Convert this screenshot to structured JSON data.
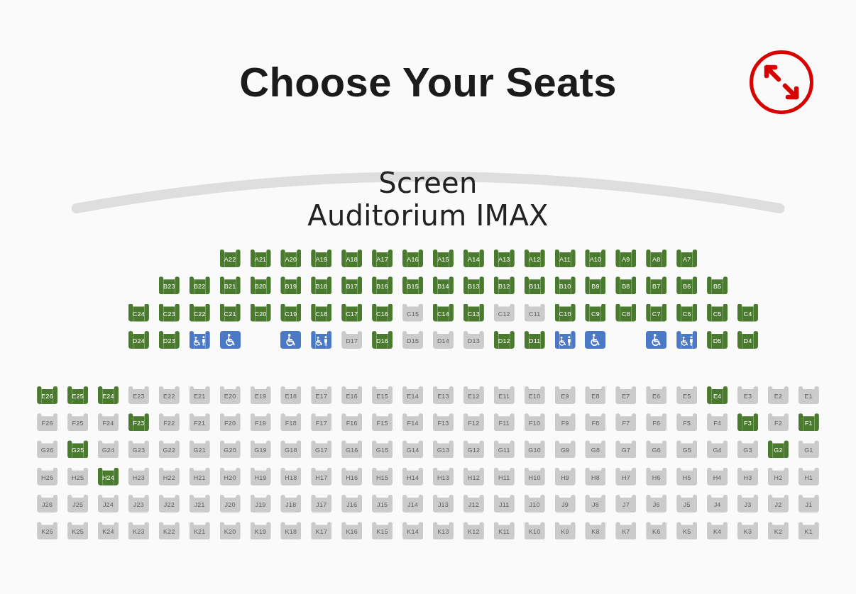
{
  "header": {
    "title": "Choose Your Seats"
  },
  "screen": {
    "label": "Screen",
    "auditorium": "Auditorium IMAX"
  },
  "sections": [
    {
      "rows": [
        {
          "seats": [
            {
              "kind": "gap"
            },
            {
              "kind": "gap"
            },
            {
              "kind": "gap"
            },
            {
              "kind": "gap"
            },
            {
              "kind": "gap"
            },
            {
              "kind": "gap"
            },
            {
              "kind": "standard",
              "label": "A22",
              "available": true
            },
            {
              "kind": "standard",
              "label": "A21",
              "available": true
            },
            {
              "kind": "standard",
              "label": "A20",
              "available": true
            },
            {
              "kind": "standard",
              "label": "A19",
              "available": true
            },
            {
              "kind": "standard",
              "label": "A18",
              "available": true
            },
            {
              "kind": "standard",
              "label": "A17",
              "available": true
            },
            {
              "kind": "standard",
              "label": "A16",
              "available": true
            },
            {
              "kind": "standard",
              "label": "A15",
              "available": true
            },
            {
              "kind": "standard",
              "label": "A14",
              "available": true
            },
            {
              "kind": "standard",
              "label": "A13",
              "available": true
            },
            {
              "kind": "standard",
              "label": "A12",
              "available": true
            },
            {
              "kind": "standard",
              "label": "A11",
              "available": true
            },
            {
              "kind": "standard",
              "label": "A10",
              "available": true
            },
            {
              "kind": "standard",
              "label": "A9",
              "available": true
            },
            {
              "kind": "standard",
              "label": "A8",
              "available": true
            },
            {
              "kind": "standard",
              "label": "A7",
              "available": true
            }
          ]
        },
        {
          "seats": [
            {
              "kind": "gap"
            },
            {
              "kind": "gap"
            },
            {
              "kind": "gap"
            },
            {
              "kind": "gap"
            },
            {
              "kind": "standard",
              "label": "B23",
              "available": true
            },
            {
              "kind": "standard",
              "label": "B22",
              "available": true
            },
            {
              "kind": "standard",
              "label": "B21",
              "available": true
            },
            {
              "kind": "standard",
              "label": "B20",
              "available": true
            },
            {
              "kind": "standard",
              "label": "B19",
              "available": true
            },
            {
              "kind": "standard",
              "label": "B18",
              "available": true
            },
            {
              "kind": "standard",
              "label": "B17",
              "available": true
            },
            {
              "kind": "standard",
              "label": "B16",
              "available": true
            },
            {
              "kind": "standard",
              "label": "B15",
              "available": true
            },
            {
              "kind": "standard",
              "label": "B14",
              "available": true
            },
            {
              "kind": "standard",
              "label": "B13",
              "available": true
            },
            {
              "kind": "standard",
              "label": "B12",
              "available": true
            },
            {
              "kind": "standard",
              "label": "B11",
              "available": true
            },
            {
              "kind": "standard",
              "label": "B10",
              "available": true
            },
            {
              "kind": "standard",
              "label": "B9",
              "available": true
            },
            {
              "kind": "standard",
              "label": "B8",
              "available": true
            },
            {
              "kind": "standard",
              "label": "B7",
              "available": true
            },
            {
              "kind": "standard",
              "label": "B6",
              "available": true
            },
            {
              "kind": "standard",
              "label": "B5",
              "available": true
            }
          ]
        },
        {
          "seats": [
            {
              "kind": "gap"
            },
            {
              "kind": "gap"
            },
            {
              "kind": "gap"
            },
            {
              "kind": "standard",
              "label": "C24",
              "available": true
            },
            {
              "kind": "standard",
              "label": "C23",
              "available": true
            },
            {
              "kind": "standard",
              "label": "C22",
              "available": true
            },
            {
              "kind": "standard",
              "label": "C21",
              "available": true
            },
            {
              "kind": "standard",
              "label": "C20",
              "available": true
            },
            {
              "kind": "standard",
              "label": "C19",
              "available": true
            },
            {
              "kind": "standard",
              "label": "C18",
              "available": true
            },
            {
              "kind": "standard",
              "label": "C17",
              "available": true
            },
            {
              "kind": "standard",
              "label": "C16",
              "available": true
            },
            {
              "kind": "standard",
              "label": "C15",
              "available": false
            },
            {
              "kind": "standard",
              "label": "C14",
              "available": true
            },
            {
              "kind": "standard",
              "label": "C13",
              "available": true
            },
            {
              "kind": "standard",
              "label": "C12",
              "available": false
            },
            {
              "kind": "standard",
              "label": "C11",
              "available": false
            },
            {
              "kind": "standard",
              "label": "C10",
              "available": true
            },
            {
              "kind": "standard",
              "label": "C9",
              "available": true
            },
            {
              "kind": "standard",
              "label": "C8",
              "available": true
            },
            {
              "kind": "standard",
              "label": "C7",
              "available": true
            },
            {
              "kind": "standard",
              "label": "C6",
              "available": true
            },
            {
              "kind": "standard",
              "label": "C5",
              "available": true
            },
            {
              "kind": "standard",
              "label": "C4",
              "available": true
            }
          ]
        },
        {
          "seats": [
            {
              "kind": "gap"
            },
            {
              "kind": "gap"
            },
            {
              "kind": "gap"
            },
            {
              "kind": "standard",
              "label": "D24",
              "available": true
            },
            {
              "kind": "standard",
              "label": "D23",
              "available": true
            },
            {
              "kind": "companion",
              "available": true
            },
            {
              "kind": "wheelchair",
              "available": true
            },
            {
              "kind": "gap"
            },
            {
              "kind": "wheelchair",
              "available": true
            },
            {
              "kind": "companion",
              "available": true
            },
            {
              "kind": "standard",
              "label": "D17",
              "available": false
            },
            {
              "kind": "standard",
              "label": "D16",
              "available": true
            },
            {
              "kind": "standard",
              "label": "D15",
              "available": false
            },
            {
              "kind": "standard",
              "label": "D14",
              "available": false
            },
            {
              "kind": "standard",
              "label": "D13",
              "available": false
            },
            {
              "kind": "standard",
              "label": "D12",
              "available": true
            },
            {
              "kind": "standard",
              "label": "D11",
              "available": true
            },
            {
              "kind": "companion",
              "available": true
            },
            {
              "kind": "wheelchair",
              "available": true
            },
            {
              "kind": "gap"
            },
            {
              "kind": "wheelchair",
              "available": true
            },
            {
              "kind": "companion",
              "available": true
            },
            {
              "kind": "standard",
              "label": "D5",
              "available": true
            },
            {
              "kind": "standard",
              "label": "D4",
              "available": true
            }
          ]
        }
      ]
    },
    {
      "rows": [
        {
          "seats": [
            {
              "kind": "standard",
              "label": "E26",
              "available": true
            },
            {
              "kind": "standard",
              "label": "E25",
              "available": true
            },
            {
              "kind": "standard",
              "label": "E24",
              "available": true
            },
            {
              "kind": "standard",
              "label": "E23",
              "available": false
            },
            {
              "kind": "standard",
              "label": "E22",
              "available": false
            },
            {
              "kind": "standard",
              "label": "E21",
              "available": false
            },
            {
              "kind": "standard",
              "label": "E20",
              "available": false
            },
            {
              "kind": "standard",
              "label": "E19",
              "available": false
            },
            {
              "kind": "standard",
              "label": "E18",
              "available": false
            },
            {
              "kind": "standard",
              "label": "E17",
              "available": false
            },
            {
              "kind": "standard",
              "label": "E16",
              "available": false
            },
            {
              "kind": "standard",
              "label": "E15",
              "available": false
            },
            {
              "kind": "standard",
              "label": "E14",
              "available": false
            },
            {
              "kind": "standard",
              "label": "E13",
              "available": false
            },
            {
              "kind": "standard",
              "label": "E12",
              "available": false
            },
            {
              "kind": "standard",
              "label": "E11",
              "available": false
            },
            {
              "kind": "standard",
              "label": "E10",
              "available": false
            },
            {
              "kind": "standard",
              "label": "E9",
              "available": false
            },
            {
              "kind": "standard",
              "label": "E8",
              "available": false
            },
            {
              "kind": "standard",
              "label": "E7",
              "available": false
            },
            {
              "kind": "standard",
              "label": "E6",
              "available": false
            },
            {
              "kind": "standard",
              "label": "E5",
              "available": false
            },
            {
              "kind": "standard",
              "label": "E4",
              "available": true
            },
            {
              "kind": "standard",
              "label": "E3",
              "available": false
            },
            {
              "kind": "standard",
              "label": "E2",
              "available": false
            },
            {
              "kind": "standard",
              "label": "E1",
              "available": false
            }
          ]
        },
        {
          "seats": [
            {
              "kind": "standard",
              "label": "F26",
              "available": false
            },
            {
              "kind": "standard",
              "label": "F25",
              "available": false
            },
            {
              "kind": "standard",
              "label": "F24",
              "available": false
            },
            {
              "kind": "standard",
              "label": "F23",
              "available": true
            },
            {
              "kind": "standard",
              "label": "F22",
              "available": false
            },
            {
              "kind": "standard",
              "label": "F21",
              "available": false
            },
            {
              "kind": "standard",
              "label": "F20",
              "available": false
            },
            {
              "kind": "standard",
              "label": "F19",
              "available": false
            },
            {
              "kind": "standard",
              "label": "F18",
              "available": false
            },
            {
              "kind": "standard",
              "label": "F17",
              "available": false
            },
            {
              "kind": "standard",
              "label": "F16",
              "available": false
            },
            {
              "kind": "standard",
              "label": "F15",
              "available": false
            },
            {
              "kind": "standard",
              "label": "F14",
              "available": false
            },
            {
              "kind": "standard",
              "label": "F13",
              "available": false
            },
            {
              "kind": "standard",
              "label": "F12",
              "available": false
            },
            {
              "kind": "standard",
              "label": "F11",
              "available": false
            },
            {
              "kind": "standard",
              "label": "F10",
              "available": false
            },
            {
              "kind": "standard",
              "label": "F9",
              "available": false
            },
            {
              "kind": "standard",
              "label": "F8",
              "available": false
            },
            {
              "kind": "standard",
              "label": "F7",
              "available": false
            },
            {
              "kind": "standard",
              "label": "F6",
              "available": false
            },
            {
              "kind": "standard",
              "label": "F5",
              "available": false
            },
            {
              "kind": "standard",
              "label": "F4",
              "available": false
            },
            {
              "kind": "standard",
              "label": "F3",
              "available": true
            },
            {
              "kind": "standard",
              "label": "F2",
              "available": false
            },
            {
              "kind": "standard",
              "label": "F1",
              "available": true
            }
          ]
        },
        {
          "seats": [
            {
              "kind": "standard",
              "label": "G26",
              "available": false
            },
            {
              "kind": "standard",
              "label": "G25",
              "available": true
            },
            {
              "kind": "standard",
              "label": "G24",
              "available": false
            },
            {
              "kind": "standard",
              "label": "G23",
              "available": false
            },
            {
              "kind": "standard",
              "label": "G22",
              "available": false
            },
            {
              "kind": "standard",
              "label": "G21",
              "available": false
            },
            {
              "kind": "standard",
              "label": "G20",
              "available": false
            },
            {
              "kind": "standard",
              "label": "G19",
              "available": false
            },
            {
              "kind": "standard",
              "label": "G18",
              "available": false
            },
            {
              "kind": "standard",
              "label": "G17",
              "available": false
            },
            {
              "kind": "standard",
              "label": "G16",
              "available": false
            },
            {
              "kind": "standard",
              "label": "G15",
              "available": false
            },
            {
              "kind": "standard",
              "label": "G14",
              "available": false
            },
            {
              "kind": "standard",
              "label": "G13",
              "available": false
            },
            {
              "kind": "standard",
              "label": "G12",
              "available": false
            },
            {
              "kind": "standard",
              "label": "G11",
              "available": false
            },
            {
              "kind": "standard",
              "label": "G10",
              "available": false
            },
            {
              "kind": "standard",
              "label": "G9",
              "available": false
            },
            {
              "kind": "standard",
              "label": "G8",
              "available": false
            },
            {
              "kind": "standard",
              "label": "G7",
              "available": false
            },
            {
              "kind": "standard",
              "label": "G6",
              "available": false
            },
            {
              "kind": "standard",
              "label": "G5",
              "available": false
            },
            {
              "kind": "standard",
              "label": "G4",
              "available": false
            },
            {
              "kind": "standard",
              "label": "G3",
              "available": false
            },
            {
              "kind": "standard",
              "label": "G2",
              "available": true
            },
            {
              "kind": "standard",
              "label": "G1",
              "available": false
            }
          ]
        },
        {
          "seats": [
            {
              "kind": "standard",
              "label": "H26",
              "available": false
            },
            {
              "kind": "standard",
              "label": "H25",
              "available": false
            },
            {
              "kind": "standard",
              "label": "H24",
              "available": true
            },
            {
              "kind": "standard",
              "label": "H23",
              "available": false
            },
            {
              "kind": "standard",
              "label": "H22",
              "available": false
            },
            {
              "kind": "standard",
              "label": "H21",
              "available": false
            },
            {
              "kind": "standard",
              "label": "H20",
              "available": false
            },
            {
              "kind": "standard",
              "label": "H19",
              "available": false
            },
            {
              "kind": "standard",
              "label": "H18",
              "available": false
            },
            {
              "kind": "standard",
              "label": "H17",
              "available": false
            },
            {
              "kind": "standard",
              "label": "H16",
              "available": false
            },
            {
              "kind": "standard",
              "label": "H15",
              "available": false
            },
            {
              "kind": "standard",
              "label": "H14",
              "available": false
            },
            {
              "kind": "standard",
              "label": "H13",
              "available": false
            },
            {
              "kind": "standard",
              "label": "H12",
              "available": false
            },
            {
              "kind": "standard",
              "label": "H11",
              "available": false
            },
            {
              "kind": "standard",
              "label": "H10",
              "available": false
            },
            {
              "kind": "standard",
              "label": "H9",
              "available": false
            },
            {
              "kind": "standard",
              "label": "H8",
              "available": false
            },
            {
              "kind": "standard",
              "label": "H7",
              "available": false
            },
            {
              "kind": "standard",
              "label": "H6",
              "available": false
            },
            {
              "kind": "standard",
              "label": "H5",
              "available": false
            },
            {
              "kind": "standard",
              "label": "H4",
              "available": false
            },
            {
              "kind": "standard",
              "label": "H3",
              "available": false
            },
            {
              "kind": "standard",
              "label": "H2",
              "available": false
            },
            {
              "kind": "standard",
              "label": "H1",
              "available": false
            }
          ]
        },
        {
          "seats": [
            {
              "kind": "standard",
              "label": "J26",
              "available": false
            },
            {
              "kind": "standard",
              "label": "J25",
              "available": false
            },
            {
              "kind": "standard",
              "label": "J24",
              "available": false
            },
            {
              "kind": "standard",
              "label": "J23",
              "available": false
            },
            {
              "kind": "standard",
              "label": "J22",
              "available": false
            },
            {
              "kind": "standard",
              "label": "J21",
              "available": false
            },
            {
              "kind": "standard",
              "label": "J20",
              "available": false
            },
            {
              "kind": "standard",
              "label": "J19",
              "available": false
            },
            {
              "kind": "standard",
              "label": "J18",
              "available": false
            },
            {
              "kind": "standard",
              "label": "J17",
              "available": false
            },
            {
              "kind": "standard",
              "label": "J16",
              "available": false
            },
            {
              "kind": "standard",
              "label": "J15",
              "available": false
            },
            {
              "kind": "standard",
              "label": "J14",
              "available": false
            },
            {
              "kind": "standard",
              "label": "J13",
              "available": false
            },
            {
              "kind": "standard",
              "label": "J12",
              "available": false
            },
            {
              "kind": "standard",
              "label": "J11",
              "available": false
            },
            {
              "kind": "standard",
              "label": "J10",
              "available": false
            },
            {
              "kind": "standard",
              "label": "J9",
              "available": false
            },
            {
              "kind": "standard",
              "label": "J8",
              "available": false
            },
            {
              "kind": "standard",
              "label": "J7",
              "available": false
            },
            {
              "kind": "standard",
              "label": "J6",
              "available": false
            },
            {
              "kind": "standard",
              "label": "J5",
              "available": false
            },
            {
              "kind": "standard",
              "label": "J4",
              "available": false
            },
            {
              "kind": "standard",
              "label": "J3",
              "available": false
            },
            {
              "kind": "standard",
              "label": "J2",
              "available": false
            },
            {
              "kind": "standard",
              "label": "J1",
              "available": false
            }
          ]
        },
        {
          "seats": [
            {
              "kind": "standard",
              "label": "K26",
              "available": false
            },
            {
              "kind": "standard",
              "label": "K25",
              "available": false
            },
            {
              "kind": "standard",
              "label": "K24",
              "available": false
            },
            {
              "kind": "standard",
              "label": "K23",
              "available": false
            },
            {
              "kind": "standard",
              "label": "K22",
              "available": false
            },
            {
              "kind": "standard",
              "label": "K21",
              "available": false
            },
            {
              "kind": "standard",
              "label": "K20",
              "available": false
            },
            {
              "kind": "standard",
              "label": "K19",
              "available": false
            },
            {
              "kind": "standard",
              "label": "K18",
              "available": false
            },
            {
              "kind": "standard",
              "label": "K17",
              "available": false
            },
            {
              "kind": "standard",
              "label": "K16",
              "available": false
            },
            {
              "kind": "standard",
              "label": "K15",
              "available": false
            },
            {
              "kind": "standard",
              "label": "K14",
              "available": false
            },
            {
              "kind": "standard",
              "label": "K13",
              "available": false
            },
            {
              "kind": "standard",
              "label": "K12",
              "available": false
            },
            {
              "kind": "standard",
              "label": "K11",
              "available": false
            },
            {
              "kind": "standard",
              "label": "K10",
              "available": false
            },
            {
              "kind": "standard",
              "label": "K9",
              "available": false
            },
            {
              "kind": "standard",
              "label": "K8",
              "available": false
            },
            {
              "kind": "standard",
              "label": "K7",
              "available": false
            },
            {
              "kind": "standard",
              "label": "K6",
              "available": false
            },
            {
              "kind": "standard",
              "label": "K5",
              "available": false
            },
            {
              "kind": "standard",
              "label": "K4",
              "available": false
            },
            {
              "kind": "standard",
              "label": "K3",
              "available": false
            },
            {
              "kind": "standard",
              "label": "K2",
              "available": false
            },
            {
              "kind": "standard",
              "label": "K1",
              "available": false
            }
          ]
        }
      ]
    }
  ]
}
